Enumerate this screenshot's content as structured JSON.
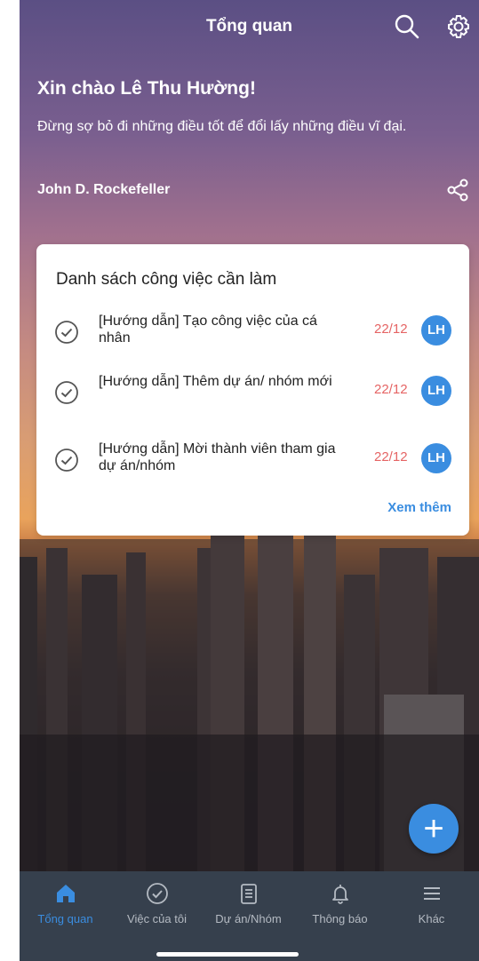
{
  "header": {
    "title": "Tổng quan",
    "search_icon": "search-icon",
    "settings_icon": "gear-icon"
  },
  "greeting": "Xin chào Lê Thu Hường!",
  "quote": {
    "text": "Đừng sợ bỏ đi những điều tốt để đổi lấy những điều vĩ đại.",
    "author": "John D. Rockefeller",
    "share_icon": "share-icon"
  },
  "todo": {
    "title": "Danh sách công việc cần làm",
    "tasks": [
      {
        "title": "[Hướng dẫn] Tạo công việc của cá nhân",
        "date": "22/12",
        "assignee": "LH"
      },
      {
        "title": "[Hướng dẫn] Thêm dự án/ nhóm mới",
        "date": "22/12",
        "assignee": "LH"
      },
      {
        "title": "[Hướng dẫn] Mời thành viên tham gia dự án/nhóm",
        "date": "22/12",
        "assignee": "LH"
      }
    ],
    "more_label": "Xem thêm"
  },
  "fab": {
    "label": "+",
    "icon": "plus-icon"
  },
  "bottom_nav": [
    {
      "label": "Tổng quan",
      "icon": "home-icon",
      "active": true
    },
    {
      "label": "Việc của tôi",
      "icon": "check-circle-icon",
      "active": false
    },
    {
      "label": "Dự án/Nhóm",
      "icon": "clipboard-icon",
      "active": false
    },
    {
      "label": "Thông báo",
      "icon": "bell-icon",
      "active": false
    },
    {
      "label": "Khác",
      "icon": "menu-icon",
      "active": false
    }
  ],
  "colors": {
    "accent": "#3a8de0",
    "due_date": "#e56464",
    "nav_bg": "#36404d"
  }
}
